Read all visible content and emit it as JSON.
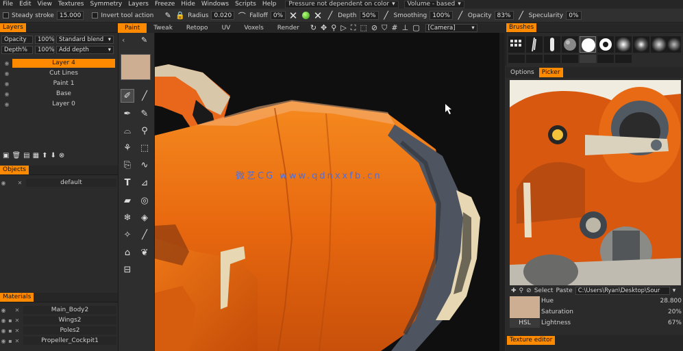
{
  "menu": [
    "File",
    "Edit",
    "View",
    "Textures",
    "Symmetry",
    "Layers",
    "Freeze",
    "Hide",
    "Windows",
    "Scripts",
    "Help"
  ],
  "menu_dropdowns": {
    "pressure": "Pressure not dependent on color",
    "volume": "Volume - based"
  },
  "toolbar": {
    "steady_stroke": "Steady stroke",
    "steady_value": "15.000",
    "invert_tool": "Invert tool action",
    "radius_label": "Radius",
    "radius_value": "0.020",
    "falloff_label": "Falloff",
    "falloff_value": "0%",
    "depth_label": "Depth",
    "depth_value": "50%",
    "smoothing_label": "Smoothing",
    "smoothing_value": "100%",
    "opacity_label": "Opacity",
    "opacity_value": "83%",
    "specularity_label": "Specularity",
    "specularity_value": "0%"
  },
  "layers_panel": {
    "title": "Layers",
    "opacity_label": "Opacity",
    "opacity_value": "100%",
    "blend_mode": "Standard blend",
    "depth_label": "Depth%",
    "depth_value": "100%",
    "depth_mode": "Add depth",
    "layers": [
      "Layer 4",
      "Cut Lines",
      "Paint 1",
      "Base",
      "Layer 0"
    ],
    "selected_index": 0
  },
  "objects_panel": {
    "title": "Objects",
    "items": [
      "default"
    ]
  },
  "materials_panel": {
    "title": "Materials",
    "items": [
      "Main_Body2",
      "Wings2",
      "Poles2",
      "Propeller_Cockpit1"
    ]
  },
  "mode_tabs": [
    "Paint",
    "Tweak",
    "Retopo",
    "UV",
    "Voxels",
    "Render"
  ],
  "active_tab": "Paint",
  "camera_dropdown": "[Camera]",
  "viewport_watermark": "微艺CG  www.qdnxxfb.cn",
  "brushes_panel": {
    "title": "Brushes"
  },
  "picker_tabs": [
    "Options",
    "Picker"
  ],
  "picker_active": "Picker",
  "picker_toolbar": {
    "select": "Select",
    "paste": "Paste",
    "path": "C:\\Users\\Ryan\\Desktop\\Sour"
  },
  "color_fields": {
    "hue_label": "Hue",
    "hue_value": "28.800",
    "saturation_label": "Saturation",
    "saturation_value": "20%",
    "lightness_label": "Lightness",
    "lightness_value": "67%",
    "model": "HSL"
  },
  "texture_editor": {
    "title": "Texture editor"
  },
  "colors": {
    "accent": "#ff8a00",
    "current_color": "#cdae93",
    "body_orange": "#e8680f"
  }
}
